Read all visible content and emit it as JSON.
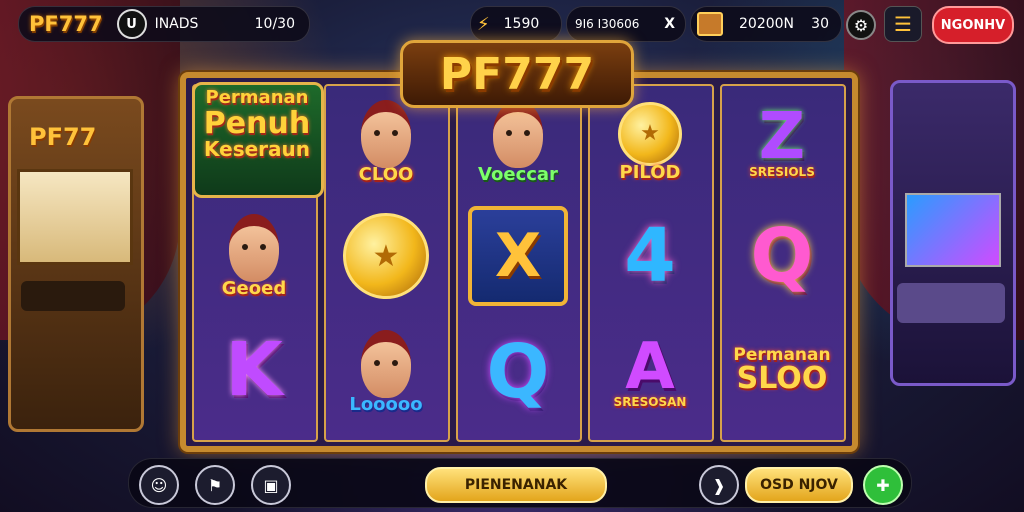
{
  "header": {
    "logo": "PF777",
    "badge": "U",
    "label": "INADS",
    "value": "10/30",
    "stat1": "1590",
    "stat2": "9I6 I30606",
    "stat2_close": "X",
    "stat3": "20200N",
    "stat3_x": "30",
    "login_label": "NGONHV"
  },
  "title_logo": "PF777",
  "promo": {
    "line1": "Permanan",
    "line2": "Penuh",
    "line3": "Keseraun"
  },
  "reels": [
    {
      "col": 1,
      "symbols": [
        {
          "kind": "person",
          "label": "Geoed"
        },
        {
          "kind": "letter",
          "label": "K",
          "color": "#c04bff"
        }
      ]
    },
    {
      "col": 2,
      "symbols": [
        {
          "kind": "person",
          "label": "CLOO"
        },
        {
          "kind": "coin",
          "label": ""
        },
        {
          "kind": "person",
          "label": "Looooo"
        }
      ]
    },
    {
      "col": 3,
      "symbols": [
        {
          "kind": "person",
          "label": "Voeccar"
        },
        {
          "kind": "letter-x",
          "label": "X"
        },
        {
          "kind": "letter",
          "label": "Q",
          "color": "#3bb7ff"
        }
      ]
    },
    {
      "col": 4,
      "symbols": [
        {
          "kind": "coin",
          "label": "PILOD"
        },
        {
          "kind": "letter",
          "label": "4",
          "color": "#2fb7ff"
        },
        {
          "kind": "letter",
          "label": "A",
          "color": "#d04bff",
          "sublabel": "SRESOSAN"
        }
      ]
    },
    {
      "col": 5,
      "symbols": [
        {
          "kind": "letter",
          "label": "Z",
          "color": "#b04bff",
          "sublabel": "SRESIOLS"
        },
        {
          "kind": "letter",
          "label": "Q",
          "color": "#ff5ad0"
        },
        {
          "kind": "text",
          "label": "Permanan",
          "sublabel": "SLOO"
        }
      ]
    }
  ],
  "side_machine_logo": "PF77",
  "footer": {
    "main_button": "PIENENANAK",
    "second_button": "OSD NJOV"
  },
  "colors": {
    "gold": "#e3a51c",
    "red_button": "#d61f2a",
    "green_button": "#2fbf3a"
  }
}
